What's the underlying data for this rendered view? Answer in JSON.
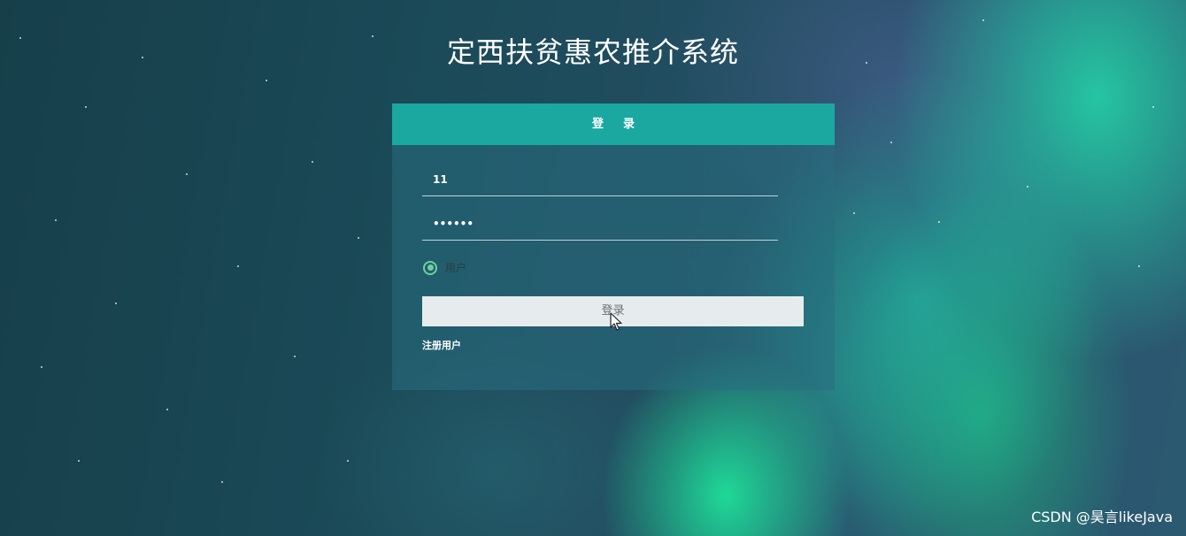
{
  "app": {
    "title": "定西扶贫惠农推介系统"
  },
  "login": {
    "header": "登录",
    "username_value": "11",
    "password_value": "123456",
    "role_label": "用户",
    "submit_label": "登录",
    "register_link": "注册用户"
  },
  "watermark": "CSDN @昊言likeJava",
  "colors": {
    "header_bg": "#1aa8a0",
    "button_bg": "#e6ecee",
    "radio_accent": "#6fd0a0"
  },
  "icons": {
    "cursor": "mouse-pointer-icon"
  }
}
